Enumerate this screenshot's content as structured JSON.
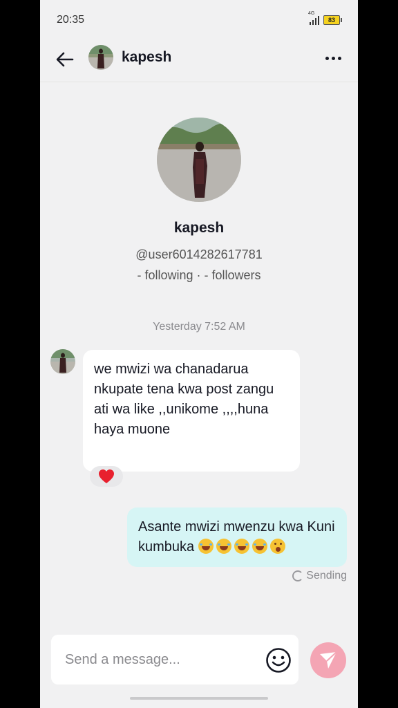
{
  "status_bar": {
    "time": "20:35",
    "network": "4G",
    "battery": "83"
  },
  "header": {
    "name": "kapesh"
  },
  "profile": {
    "name": "kapesh",
    "handle": "@user6014282617781",
    "stats": "- following · - followers"
  },
  "conversation": {
    "timestamp": "Yesterday 7:52 AM",
    "incoming": {
      "text": "we mwizi wa chanadarua nkupate tena kwa post zangu ati wa like ,,unikome ,,,,huna haya muone",
      "reaction": "heart"
    },
    "outgoing": {
      "text": "Asante mwizi mwenzu kwa Kuni kumbuka",
      "emojis": [
        "laughing-tears",
        "laughing-tears",
        "laughing-tears",
        "laughing-tears",
        "shocked"
      ],
      "status": "Sending"
    }
  },
  "composer": {
    "placeholder": "Send a message..."
  },
  "colors": {
    "accent": "#fe2c55",
    "send_button": "#f4a5b4",
    "outgoing_bubble": "#d6f5f5",
    "background": "#f1f1f2"
  }
}
